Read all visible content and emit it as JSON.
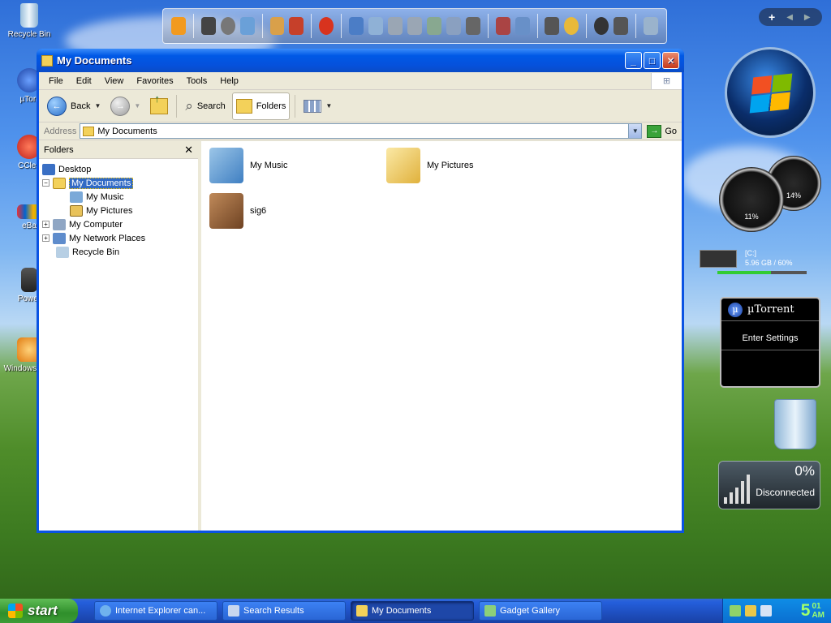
{
  "desktop": {
    "icons": [
      {
        "label": "Recycle Bin"
      },
      {
        "label": "µTorr"
      },
      {
        "label": "CClea"
      },
      {
        "label": "eBa"
      },
      {
        "label": "Power"
      },
      {
        "label": "Windows Play"
      }
    ]
  },
  "window": {
    "title": "My Documents",
    "menu": [
      "File",
      "Edit",
      "View",
      "Favorites",
      "Tools",
      "Help"
    ],
    "toolbar": {
      "back_label": "Back",
      "search_label": "Search",
      "folders_label": "Folders"
    },
    "address": {
      "label": "Address",
      "value": "My Documents",
      "go_label": "Go"
    },
    "folders_pane": {
      "title": "Folders",
      "tree": [
        {
          "label": "Desktop"
        },
        {
          "label": "My Documents"
        },
        {
          "label": "My Music"
        },
        {
          "label": "My Pictures"
        },
        {
          "label": "My Computer"
        },
        {
          "label": "My Network Places"
        },
        {
          "label": "Recycle Bin"
        }
      ]
    },
    "items": [
      {
        "label": "My Music"
      },
      {
        "label": "My Pictures"
      },
      {
        "label": "sig6"
      }
    ]
  },
  "gadgets": {
    "cpu_gauge": "11%",
    "ram_gauge": "14%",
    "drive": {
      "name": "[C:]",
      "usage": "5.96 GB / 60%",
      "fill_pct": 60
    },
    "utorrent": {
      "title": "µTorrent",
      "body": "Enter Settings"
    },
    "network": {
      "percent": "0%",
      "status": "Disconnected"
    }
  },
  "taskbar": {
    "start_label": "start",
    "tasks": [
      {
        "label": "Internet Explorer can..."
      },
      {
        "label": "Search Results"
      },
      {
        "label": "My Documents"
      },
      {
        "label": "Gadget Gallery"
      }
    ],
    "clock": {
      "hour": "5",
      "minutes": "01",
      "ampm": "AM"
    }
  },
  "colors": {
    "titlebar": "#0059e6",
    "selection": "#316ac5",
    "start_button": "#3d9b36",
    "taskbar": "#245edb"
  }
}
